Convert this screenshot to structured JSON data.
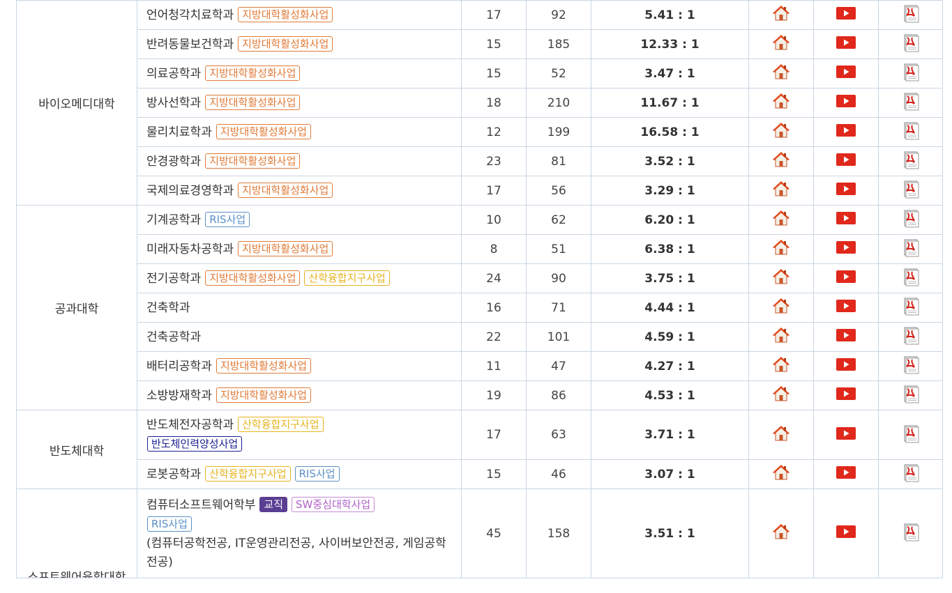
{
  "colors": {
    "border": "#c9d6e3",
    "badge_orange": "#e07b39",
    "badge_blue": "#5b8fc7",
    "badge_yellow": "#e6b31e",
    "badge_navy": "#1b1f8f",
    "badge_purple": "#b061c9",
    "badge_solid_bg": "#5a3e92",
    "youtube_red": "#e0281b"
  },
  "icons": {
    "home": "home-icon",
    "video": "video-play-icon",
    "pdf": "pdf-document-icon"
  },
  "colleges": [
    {
      "name": "바이오메디대학",
      "rows": [
        {
          "dept": "언어청각치료학과",
          "badges": [
            {
              "text": "지방대학활성화사업",
              "style": "orange"
            }
          ],
          "quota": "17",
          "applicants": "92",
          "ratio": "5.41 : 1"
        },
        {
          "dept": "반려동물보건학과",
          "badges": [
            {
              "text": "지방대학활성화사업",
              "style": "orange"
            }
          ],
          "quota": "15",
          "applicants": "185",
          "ratio": "12.33 : 1"
        },
        {
          "dept": "의료공학과",
          "badges": [
            {
              "text": "지방대학활성화사업",
              "style": "orange"
            }
          ],
          "quota": "15",
          "applicants": "52",
          "ratio": "3.47 : 1"
        },
        {
          "dept": "방사선학과",
          "badges": [
            {
              "text": "지방대학활성화사업",
              "style": "orange"
            }
          ],
          "quota": "18",
          "applicants": "210",
          "ratio": "11.67 : 1"
        },
        {
          "dept": "물리치료학과",
          "badges": [
            {
              "text": "지방대학활성화사업",
              "style": "orange"
            }
          ],
          "quota": "12",
          "applicants": "199",
          "ratio": "16.58 : 1"
        },
        {
          "dept": "안경광학과",
          "badges": [
            {
              "text": "지방대학활성화사업",
              "style": "orange"
            }
          ],
          "quota": "23",
          "applicants": "81",
          "ratio": "3.52 : 1"
        },
        {
          "dept": "국제의료경영학과",
          "badges": [
            {
              "text": "지방대학활성화사업",
              "style": "orange"
            }
          ],
          "quota": "17",
          "applicants": "56",
          "ratio": "3.29 : 1"
        }
      ]
    },
    {
      "name": "공과대학",
      "rows": [
        {
          "dept": "기계공학과",
          "badges": [
            {
              "text": "RIS사업",
              "style": "blue"
            }
          ],
          "quota": "10",
          "applicants": "62",
          "ratio": "6.20 : 1"
        },
        {
          "dept": "미래자동차공학과",
          "badges": [
            {
              "text": "지방대학활성화사업",
              "style": "orange"
            }
          ],
          "quota": "8",
          "applicants": "51",
          "ratio": "6.38 : 1"
        },
        {
          "dept": "전기공학과",
          "badges": [
            {
              "text": "지방대학활성화사업",
              "style": "orange"
            },
            {
              "text": "산학융합지구사업",
              "style": "yellow"
            }
          ],
          "quota": "24",
          "applicants": "90",
          "ratio": "3.75 : 1"
        },
        {
          "dept": "건축학과",
          "badges": [],
          "quota": "16",
          "applicants": "71",
          "ratio": "4.44 : 1"
        },
        {
          "dept": "건축공학과",
          "badges": [],
          "quota": "22",
          "applicants": "101",
          "ratio": "4.59 : 1"
        },
        {
          "dept": "배터리공학과",
          "badges": [
            {
              "text": "지방대학활성화사업",
              "style": "orange"
            }
          ],
          "quota": "11",
          "applicants": "47",
          "ratio": "4.27 : 1"
        },
        {
          "dept": "소방방재학과",
          "badges": [
            {
              "text": "지방대학활성화사업",
              "style": "orange"
            }
          ],
          "quota": "19",
          "applicants": "86",
          "ratio": "4.53 : 1"
        }
      ]
    },
    {
      "name": "반도체대학",
      "rows": [
        {
          "dept": "반도체전자공학과",
          "badges": [
            {
              "text": "산학융합지구사업",
              "style": "yellow"
            }
          ],
          "badges2": [
            {
              "text": "반도체인력양성사업",
              "style": "navy"
            }
          ],
          "quota": "17",
          "applicants": "63",
          "ratio": "3.71 : 1"
        },
        {
          "dept": "로봇공학과",
          "badges": [
            {
              "text": "산학융합지구사업",
              "style": "yellow"
            },
            {
              "text": "RIS사업",
              "style": "blue"
            }
          ],
          "quota": "15",
          "applicants": "46",
          "ratio": "3.07 : 1"
        }
      ]
    },
    {
      "name": "소프트웨어융합대학",
      "rows": [
        {
          "dept": "컴퓨터소프트웨어학부",
          "badges": [
            {
              "text": "교직",
              "style": "solid"
            },
            {
              "text": "SW중심대학사업",
              "style": "purple"
            }
          ],
          "badges2": [
            {
              "text": "RIS사업",
              "style": "blue"
            }
          ],
          "sub": "(컴퓨터공학전공, IT운영관리전공, 사이버보안전공, 게임공학전공)",
          "quota": "45",
          "applicants": "158",
          "ratio": "3.51 : 1"
        }
      ]
    }
  ]
}
